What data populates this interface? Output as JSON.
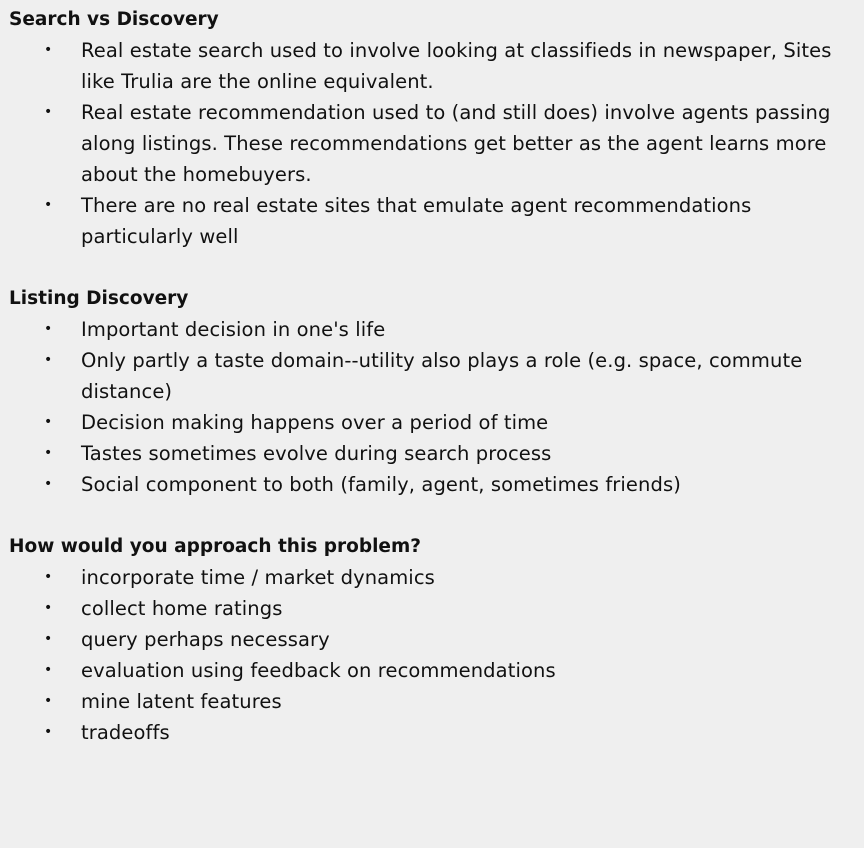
{
  "sections": [
    {
      "title": "Search vs Discovery",
      "bullets": [
        "Real estate search used to involve looking at classifieds in newspaper, Sites like Trulia are the online equivalent.",
        "Real estate recommendation used to (and still does) involve agents passing along listings.  These recommendations get better as the agent learns more about the homebuyers.",
        "There are no real estate sites that emulate agent recommendations particularly well"
      ]
    },
    {
      "title": "Listing Discovery",
      "bullets": [
        "Important decision in one's life",
        "Only partly a taste domain--utility also plays a role (e.g. space, commute distance)",
        "Decision making happens over a period of time",
        "Tastes sometimes evolve during search process",
        "Social component to both (family, agent, sometimes friends)"
      ]
    },
    {
      "title": "How would you approach this problem?",
      "bullets": [
        "incorporate time / market dynamics",
        "collect home ratings",
        "query perhaps necessary",
        "evaluation using feedback on recommendations",
        "mine latent features",
        "tradeoffs"
      ]
    }
  ]
}
